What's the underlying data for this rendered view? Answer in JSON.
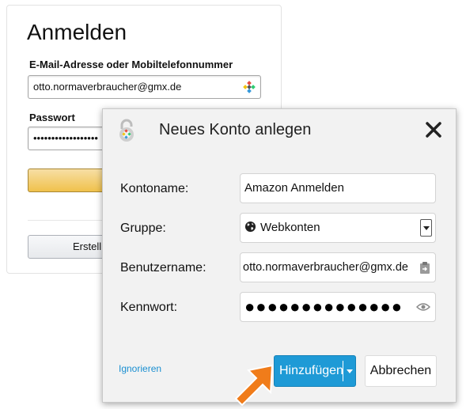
{
  "login": {
    "title": "Anmelden",
    "email_label": "E-Mail-Adresse oder Mobiltelefonnummer",
    "email_value": "otto.normaverbraucher@gmx.de",
    "password_label": "Passwort",
    "password_value": "••••••••••••••••••",
    "create_button_label": "Erstell"
  },
  "dialog": {
    "title": "Neues Konto anlegen",
    "fields": {
      "kontoname_label": "Kontoname:",
      "kontoname_value": "Amazon Anmelden",
      "gruppe_label": "Gruppe:",
      "gruppe_value": "Webkonten",
      "benutzername_label": "Benutzername:",
      "benutzername_value": "otto.normaverbraucher@gmx.de",
      "kennwort_label": "Kennwort:",
      "kennwort_value": "●●●●●●●●●●●●●●"
    },
    "ignore_label": "Ignorieren",
    "add_label": "Hinzufügen",
    "cancel_label": "Abbrechen"
  },
  "colors": {
    "accent_blue": "#1e9ad6",
    "link_blue": "#1a8fd1",
    "arrow_orange": "#f07c1a"
  },
  "icons": [
    "key-icon",
    "lock-logo-icon",
    "close-icon",
    "globe-icon",
    "clipboard-icon",
    "eye-icon",
    "chevron-down-icon",
    "pointer-arrow-icon"
  ]
}
